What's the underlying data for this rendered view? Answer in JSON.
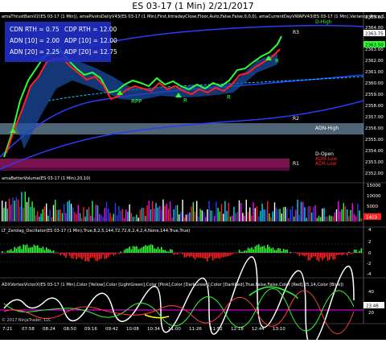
{
  "window": {
    "title": "ES 03-17 (1 Min)  2/21/2017"
  },
  "colors": {
    "background": "#000000",
    "accent_blue": "#2b3bff",
    "cyan": "#00d5ff",
    "green": "#2bff34",
    "red": "#ff2020",
    "magenta": "#ff00ff",
    "yellow": "#ffff00"
  },
  "panels": {
    "price": {
      "header": "amaThrustBarsV2(ES 03-17 (1 Min)), amaPivotsDailyV43(ES 03-17 (1 Min),First,IntradayClose,Floor,Auto,False,False,0,0,0), amaCurrentDayVWAPV43(ES 03-17 (1 Min),Variance_Price,1,",
      "legend": [
        {
          "label": "CDN RTH = 0.75",
          "col": 0
        },
        {
          "label": "CDP RTH = 12.00",
          "col": 1
        },
        {
          "label": "ADN [10] = 2.00",
          "col": 0
        },
        {
          "label": "ADP [10] = 12.00",
          "col": 1
        },
        {
          "label": "ADN [20] = 2.25",
          "col": 0
        },
        {
          "label": "ADP [20] = 12.75",
          "col": 1
        }
      ],
      "axis_labels": [
        "2365.00",
        "2364.00",
        "2363.00",
        "2362.00",
        "2361.00",
        "2360.00",
        "2359.00",
        "2358.00",
        "2357.00",
        "2356.00",
        "2355.00",
        "2354.00",
        "2353.00",
        "2352.00"
      ],
      "current_price": "2363.75",
      "price_box": "2363.50",
      "level_labels": [
        "R3",
        "D-High",
        "R2",
        "ADN-High",
        "D-Open",
        "ADN-Low",
        "R1",
        "ADR-Low"
      ],
      "markers": [
        "R",
        "RPP",
        "R",
        "R",
        "R"
      ]
    },
    "volume": {
      "header": "amaBetterVolume(ES 03-17 (1 Min),20,10)",
      "axis_labels": [
        "15000",
        "10000",
        "5000"
      ],
      "current_value": "1403"
    },
    "oscillator": {
      "header": "LT_Zerolag_Oscillator(ES 03-17 (1 Min),True,8,2,5,144,72,72,6,2,4,2,4,None,144,True,True)",
      "axis_labels": [
        "4",
        "2",
        "0",
        "-2",
        "-4"
      ]
    },
    "adx": {
      "header": "ADXVortexVictorX(ES 03-17 (1 Min),Color [Yellow],Color [LightGreen],Color [Pink],Color [DarkGreen],Color [DarkRed],True,False,False,Color [Red],25,14,Color [Blue])",
      "axis_labels": [
        "40",
        "20"
      ],
      "current_value": "23.48"
    }
  },
  "time_axis": [
    "7:21",
    "07:58",
    "08:24",
    "08:50",
    "09:16",
    "09:42",
    "10:08",
    "10:34",
    "11:00",
    "11:26",
    "11:52",
    "12:18",
    "12:44",
    "13:10"
  ],
  "copyright": "© 2017 NinjaTrader, LLC"
}
